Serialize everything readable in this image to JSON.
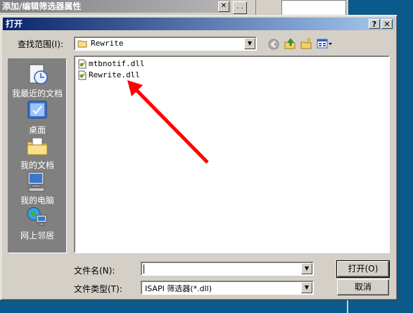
{
  "background_window": {
    "title": "添加/编辑筛选器属性",
    "close_glyph": "✕",
    "ellipsis": ". ."
  },
  "dialog": {
    "title": "打开",
    "help_glyph": "?",
    "close_glyph": "✕"
  },
  "lookin": {
    "label": "查找范围(I):",
    "value": "Rewrite"
  },
  "places": [
    {
      "label": "我最近的文档",
      "icon": "recent-documents-icon"
    },
    {
      "label": "桌面",
      "icon": "desktop-icon"
    },
    {
      "label": "我的文档",
      "icon": "my-documents-icon"
    },
    {
      "label": "我的电脑",
      "icon": "my-computer-icon"
    },
    {
      "label": "网上邻居",
      "icon": "network-places-icon"
    }
  ],
  "files": [
    {
      "name": "mtbnotif.dll"
    },
    {
      "name": "Rewrite.dll"
    }
  ],
  "filename": {
    "label": "文件名(N):",
    "value": ""
  },
  "filetype": {
    "label": "文件类型(T):",
    "value": "ISAPI 筛选器(*.dll)"
  },
  "buttons": {
    "open": "打开(O)",
    "cancel": "取消"
  },
  "colors": {
    "titlebar": "#0a246a",
    "dialog_bg": "#d4d0c8",
    "desktop": "#0b5a8c",
    "annotation_arrow": "#ff0000"
  }
}
